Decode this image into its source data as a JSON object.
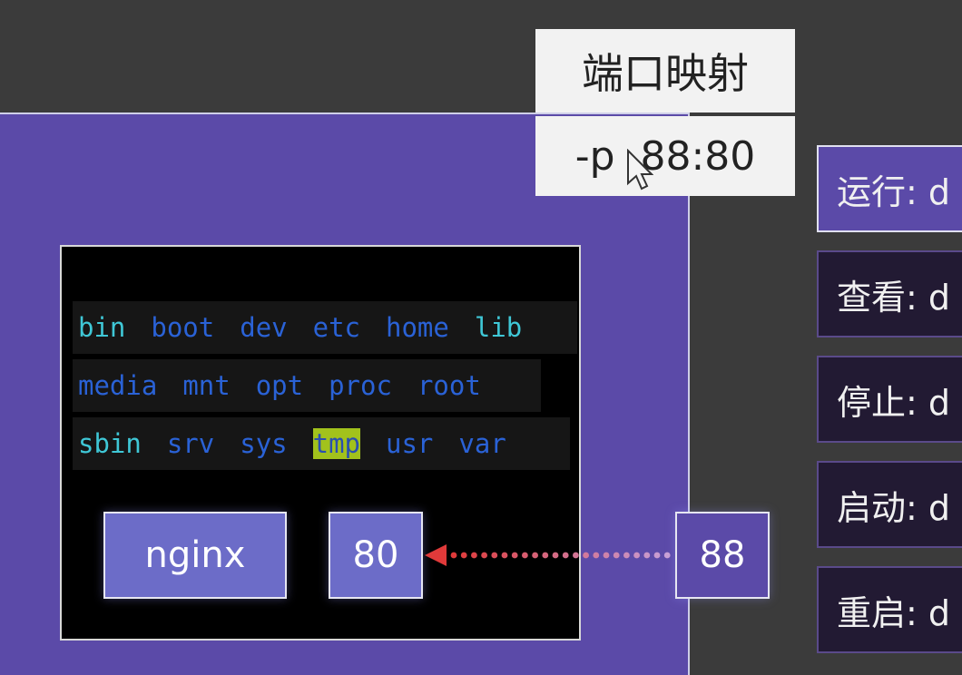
{
  "label": {
    "title": "端口映射",
    "command": "-p  88:80"
  },
  "filesystem": {
    "rows": [
      [
        {
          "name": "bin",
          "color": "cyan"
        },
        {
          "name": "boot",
          "color": "blue"
        },
        {
          "name": "dev",
          "color": "blue"
        },
        {
          "name": "etc",
          "color": "blue"
        },
        {
          "name": "home",
          "color": "blue"
        },
        {
          "name": "lib",
          "color": "cyan"
        }
      ],
      [
        {
          "name": "media",
          "color": "blue"
        },
        {
          "name": "mnt",
          "color": "blue"
        },
        {
          "name": "opt",
          "color": "blue"
        },
        {
          "name": "proc",
          "color": "blue"
        },
        {
          "name": "root",
          "color": "blue"
        }
      ],
      [
        {
          "name": "sbin",
          "color": "cyan"
        },
        {
          "name": "srv",
          "color": "blue"
        },
        {
          "name": "sys",
          "color": "blue"
        },
        {
          "name": "tmp",
          "color": "tmp"
        },
        {
          "name": "usr",
          "color": "blue"
        },
        {
          "name": "var",
          "color": "blue"
        }
      ]
    ]
  },
  "container": {
    "app": "nginx",
    "port": "80"
  },
  "host": {
    "port": "88"
  },
  "menu": [
    {
      "label": "运行:  d",
      "active": true
    },
    {
      "label": "查看:  d",
      "active": false
    },
    {
      "label": "停止:  d",
      "active": false
    },
    {
      "label": "启动:  d",
      "active": false
    },
    {
      "label": "重启:  d",
      "active": false
    }
  ],
  "colors": {
    "host_bg": "#5b4aa8",
    "pill": "#6c6cc8",
    "arrow": "#e03a3a",
    "dots": "#c77ad6"
  }
}
